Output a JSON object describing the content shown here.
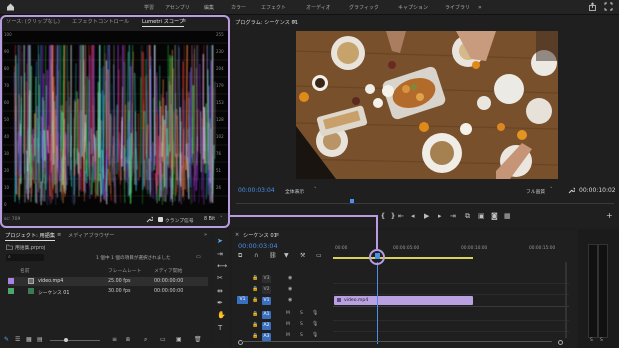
{
  "menu": {
    "items": [
      "学習",
      "アセンブリ",
      "編集",
      "カラー",
      "エフェクト",
      "オーディオ",
      "グラフィック",
      "キャプション",
      "ライブラリ"
    ]
  },
  "source_panel": {
    "tabs": [
      "ソース: (クリップなし)",
      "エフェクトコントロール",
      "Lumetri スコープ"
    ],
    "active_tab": "Lumetri スコープ",
    "scale_left": [
      "100",
      "90",
      "80",
      "70",
      "60",
      "50",
      "40",
      "30",
      "20",
      "10",
      "0"
    ],
    "scale_right": [
      "255",
      "230",
      "204",
      "179",
      "153",
      "128",
      "102",
      "76",
      "51",
      "26"
    ],
    "bottom_left": "sc: 709",
    "clamp_label": "クランプ信号",
    "clamp_checked": true,
    "bit_depth": "8 Bit"
  },
  "program_panel": {
    "title": "プログラム: シーケンス 01",
    "timecode": "00:00:03:04",
    "zoom": "全体表示",
    "quality": "フル画質",
    "duration": "00:00:10:02"
  },
  "project_panel": {
    "tabs": [
      "プロジェクト: 用語集",
      "メディアブラウザー"
    ],
    "project_file": "用語集.prproj",
    "selection_info": "1 個中 1 個の項目が選択されました",
    "columns": [
      "名前",
      "フレームレート",
      "メディア開始"
    ],
    "items": [
      {
        "name": "video.mp4",
        "fps": "25.00 fps",
        "start": "00:00:00:00",
        "color": "#a783e3"
      },
      {
        "name": "シーケンス 01",
        "fps": "30.00 fps",
        "start": "00:00:00:00",
        "color": "#4aa66a"
      }
    ]
  },
  "timeline": {
    "tab": "シーケンス 01",
    "timecode": "00:00:03:04",
    "ruler": [
      "00:00",
      "00:00:05:00",
      "00:00:10:00",
      "00:00:15:00"
    ],
    "video_tracks": [
      "V3",
      "V2",
      "V1"
    ],
    "audio_tracks": [
      "A1",
      "A2",
      "A3"
    ],
    "source_patch": "V1",
    "clip_name": "video.mp4",
    "clip_color": "#b9a0e0"
  },
  "colors": {
    "accent_blue": "#4a8fe8",
    "highlight_purple": "#b89de0"
  }
}
